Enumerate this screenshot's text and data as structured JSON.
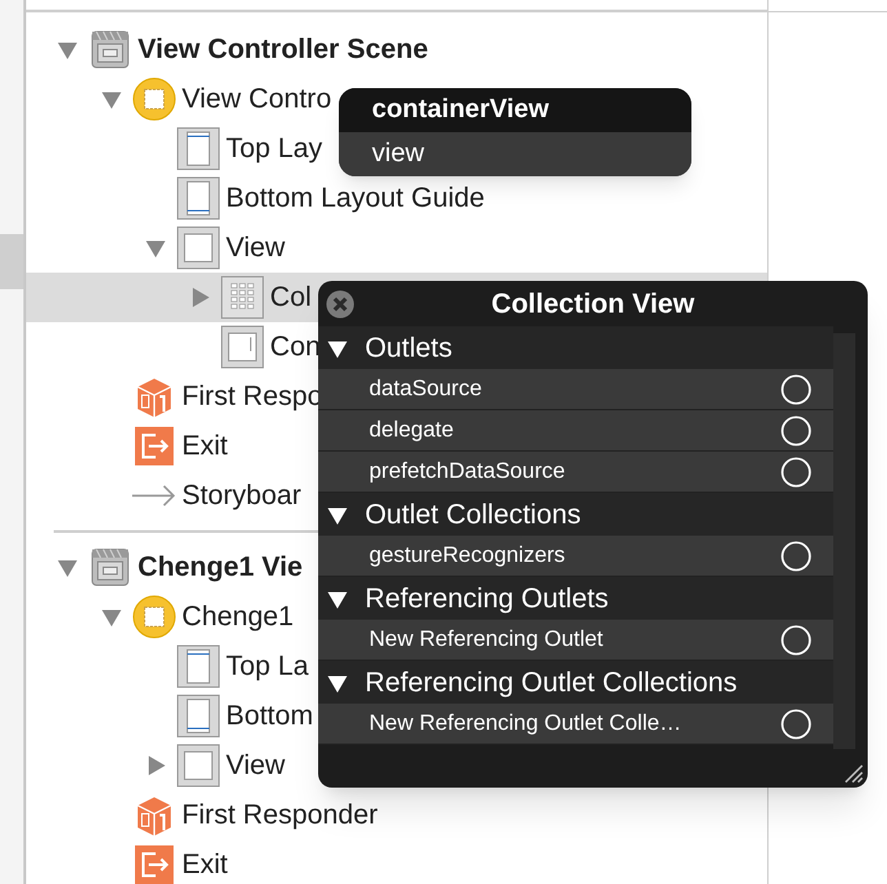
{
  "outline": [
    {
      "label": "View Controller Scene",
      "kind": "scene",
      "expanded": true,
      "selected": false,
      "children": [
        {
          "label": "View Contro",
          "kind": "controller",
          "expanded": true,
          "selected": false,
          "children": [
            {
              "label": "Top Lay",
              "kind": "top-guide",
              "selected": false
            },
            {
              "label": "Bottom Layout Guide",
              "kind": "bottom-guide",
              "selected": false
            },
            {
              "label": "View",
              "kind": "view",
              "expanded": true,
              "selected": false,
              "children": [
                {
                  "label": "Col",
                  "kind": "collection",
                  "expanded": false,
                  "selected": true
                },
                {
                  "label": "Con",
                  "kind": "container",
                  "selected": false
                }
              ]
            }
          ]
        },
        {
          "label": "First Respo",
          "kind": "responder",
          "selected": false
        },
        {
          "label": "Exit",
          "kind": "exit",
          "selected": false
        },
        {
          "label": "Storyboar",
          "kind": "entry",
          "selected": false
        }
      ]
    },
    {
      "label": "Chenge1 Vie",
      "kind": "scene",
      "expanded": true,
      "selected": false,
      "children": [
        {
          "label": "Chenge1",
          "kind": "controller",
          "expanded": true,
          "selected": false,
          "children": [
            {
              "label": "Top La",
              "kind": "top-guide",
              "selected": false
            },
            {
              "label": "Bottom",
              "kind": "bottom-guide",
              "selected": false
            },
            {
              "label": "View",
              "kind": "view",
              "expanded": false,
              "selected": false
            }
          ]
        },
        {
          "label": "First Responder",
          "kind": "responder",
          "selected": false
        },
        {
          "label": "Exit",
          "kind": "exit",
          "selected": false
        }
      ]
    }
  ],
  "outlet_menu": {
    "items": [
      {
        "label": "containerView",
        "selected": true
      },
      {
        "label": "view",
        "selected": false
      }
    ]
  },
  "connections_panel": {
    "title": "Collection View",
    "sections": [
      {
        "title": "Outlets",
        "expanded": true,
        "items": [
          "dataSource",
          "delegate",
          "prefetchDataSource"
        ]
      },
      {
        "title": "Outlet Collections",
        "expanded": true,
        "items": [
          "gestureRecognizers"
        ]
      },
      {
        "title": "Referencing Outlets",
        "expanded": true,
        "items": [
          "New Referencing Outlet"
        ]
      },
      {
        "title": "Referencing Outlet Collections",
        "expanded": true,
        "items": [
          "New Referencing Outlet Colle…"
        ]
      }
    ]
  }
}
